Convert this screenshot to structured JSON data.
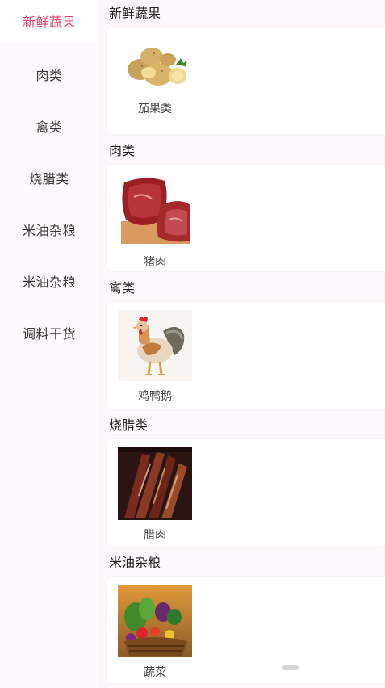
{
  "sidebar": {
    "items": [
      {
        "label": "新鲜蔬果",
        "active": true
      },
      {
        "label": "肉类"
      },
      {
        "label": "禽类"
      },
      {
        "label": "烧腊类"
      },
      {
        "label": "米油杂粮"
      },
      {
        "label": "米油杂粮"
      },
      {
        "label": "调料干货"
      }
    ]
  },
  "sections": [
    {
      "title": "新鲜蔬果",
      "product": {
        "name": "茄果类",
        "icon": "potato-image"
      }
    },
    {
      "title": "肉类",
      "product": {
        "name": "猪肉",
        "icon": "pork-image"
      }
    },
    {
      "title": "禽类",
      "product": {
        "name": "鸡鸭鹅",
        "icon": "rooster-image"
      }
    },
    {
      "title": "烧腊类",
      "product": {
        "name": "腊肉",
        "icon": "cured-meat-image"
      }
    },
    {
      "title": "米油杂粮",
      "product": {
        "name": "蔬菜",
        "icon": "vegetable-basket-image"
      }
    }
  ],
  "colors": {
    "accent": "#e03f66",
    "background": "#fbf7fa",
    "card": "#ffffff"
  }
}
